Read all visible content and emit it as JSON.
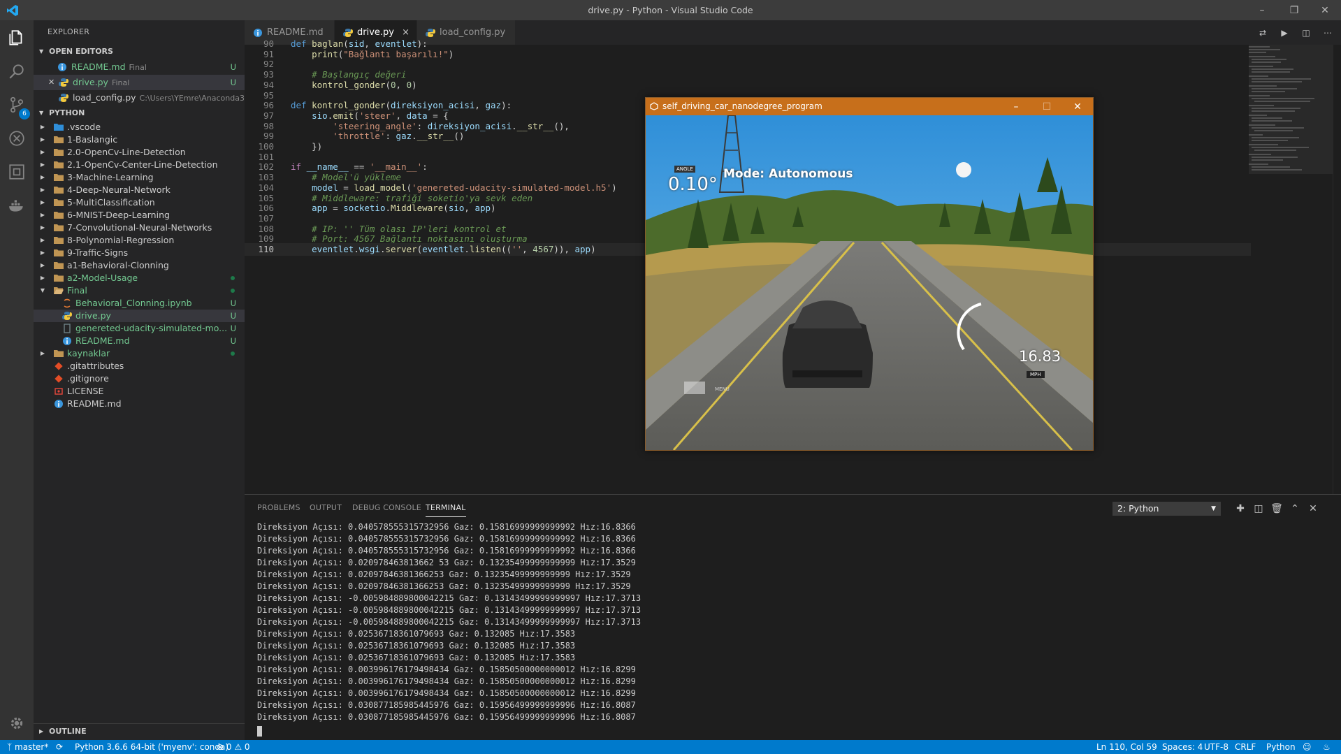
{
  "window": {
    "title": "drive.py - Python - Visual Studio Code"
  },
  "activity": {
    "scm_badge": "6"
  },
  "sidebar": {
    "title": "EXPLORER",
    "open_editors_header": "OPEN EDITORS",
    "open_editors": [
      {
        "name": "README.md",
        "desc": "Final",
        "status": "U"
      },
      {
        "name": "drive.py",
        "desc": "Final",
        "status": "U"
      },
      {
        "name": "load_config.py",
        "desc": "C:\\Users\\YEmre\\Anaconda3..."
      }
    ],
    "workspace_header": "PYTHON",
    "tree": [
      ".vscode",
      "1-Baslangic",
      "2.0-OpenCv-Line-Detection",
      "2.1-OpenCv-Center-Line-Detection",
      "3-Machine-Learning",
      "4-Deep-Neural-Network",
      "5-MultiClassification",
      "6-MNIST-Deep-Learning",
      "7-Convolutional-Neural-Networks",
      "8-Polynomial-Regression",
      "9-Traffic-Signs",
      "a1-Behavioral-Clonning",
      "a2-Model-Usage",
      "Final",
      "Behavioral_Clonning.ipynb",
      "drive.py",
      "genereted-udacity-simulated-mo...",
      "README.md",
      "kaynaklar",
      ".gitattributes",
      ".gitignore",
      "LICENSE",
      "README.md"
    ],
    "status_u": "U",
    "outline_header": "OUTLINE"
  },
  "tabs": [
    {
      "label": "README.md"
    },
    {
      "label": "drive.py",
      "close": "×"
    },
    {
      "label": "load_config.py"
    }
  ],
  "editor": {
    "lines": [
      {
        "n": "90",
        "t": "def baglan(sid, eventlet):"
      },
      {
        "n": "91",
        "t": "    print(\"Bağlantı başarılı!\")"
      },
      {
        "n": "92",
        "t": ""
      },
      {
        "n": "93",
        "t": "    # Başlangıç değeri"
      },
      {
        "n": "94",
        "t": "    kontrol_gonder(0, 0)"
      },
      {
        "n": "95",
        "t": ""
      },
      {
        "n": "96",
        "t": "def kontrol_gonder(direksiyon_acisi, gaz):"
      },
      {
        "n": "97",
        "t": "    sio.emit('steer', data = {"
      },
      {
        "n": "98",
        "t": "        'steering_angle': direksiyon_acisi.__str__(),"
      },
      {
        "n": "99",
        "t": "        'throttle': gaz.__str__()"
      },
      {
        "n": "100",
        "t": "    })"
      },
      {
        "n": "101",
        "t": ""
      },
      {
        "n": "102",
        "t": "if __name__ == '__main__':"
      },
      {
        "n": "103",
        "t": "    # Model'ü yükleme"
      },
      {
        "n": "104",
        "t": "    model = load_model('genereted-udacity-simulated-model.h5')"
      },
      {
        "n": "105",
        "t": "    # Middleware: trafiği soketio'ya sevk eden"
      },
      {
        "n": "106",
        "t": "    app = socketio.Middleware(sio, app)"
      },
      {
        "n": "107",
        "t": ""
      },
      {
        "n": "108",
        "t": "    # IP: '' Tüm olası IP'leri kontrol et"
      },
      {
        "n": "109",
        "t": "    # Port: 4567 Bağlantı noktasını oluşturma"
      },
      {
        "n": "110",
        "t": "    eventlet.wsgi.server(eventlet.listen(('', 4567)), app)"
      }
    ]
  },
  "panel": {
    "tabs": [
      "PROBLEMS",
      "OUTPUT",
      "DEBUG CONSOLE",
      "TERMINAL"
    ],
    "terminal_select": "2: Python",
    "terminal_lines": [
      "Direksiyon Açısı: 0.040578555315732956 Gaz: 0.15816999999999992 Hız:16.8366",
      "Direksiyon Açısı: 0.040578555315732956 Gaz: 0.15816999999999992 Hız:16.8366",
      "Direksiyon Açısı: 0.040578555315732956 Gaz: 0.15816999999999992 Hız:16.8366",
      "Direksiyon Açısı: 0.020978463813662 53 Gaz: 0.13235499999999999 Hız:17.3529",
      "Direksiyon Açısı: 0.02097846381366253 Gaz: 0.13235499999999999 Hız:17.3529",
      "Direksiyon Açısı: 0.02097846381366253 Gaz: 0.13235499999999999 Hız:17.3529",
      "Direksiyon Açısı: -0.005984889800042215 Gaz: 0.13143499999999997 Hız:17.3713",
      "Direksiyon Açısı: -0.005984889800042215 Gaz: 0.13143499999999997 Hız:17.3713",
      "Direksiyon Açısı: -0.005984889800042215 Gaz: 0.13143499999999997 Hız:17.3713",
      "Direksiyon Açısı: 0.02536718361079693 Gaz: 0.132085 Hız:17.3583",
      "Direksiyon Açısı: 0.02536718361079693 Gaz: 0.132085 Hız:17.3583",
      "Direksiyon Açısı: 0.02536718361079693 Gaz: 0.132085 Hız:17.3583",
      "Direksiyon Açısı: 0.003996176179498434 Gaz: 0.15850500000000012 Hız:16.8299",
      "Direksiyon Açısı: 0.003996176179498434 Gaz: 0.15850500000000012 Hız:16.8299",
      "Direksiyon Açısı: 0.003996176179498434 Gaz: 0.15850500000000012 Hız:16.8299",
      "Direksiyon Açısı: 0.030877185985445976 Gaz: 0.15956499999999996 Hız:16.8087",
      "Direksiyon Açısı: 0.030877185985445976 Gaz: 0.15956499999999996 Hız:16.8087"
    ]
  },
  "statusbar": {
    "branch": "master*",
    "interpreter": "Python 3.6.6 64-bit ('myenv': conda)",
    "errors": "0",
    "warnings": "0",
    "position": "Ln 110, Col 59",
    "spaces": "Spaces: 4",
    "encoding": "UTF-8",
    "eol": "CRLF",
    "language": "Python"
  },
  "simulator": {
    "title": "self_driving_car_nanodegree_program",
    "angle_label": "ANGLE",
    "angle": "0.10°",
    "mode": "Mode: Autonomous",
    "speed": "16.83",
    "unit": "MPH",
    "menu": "MENU"
  },
  "colors": {
    "accent": "#007acc",
    "sim_titlebar": "#c76f1b",
    "untracked": "#73c991"
  }
}
